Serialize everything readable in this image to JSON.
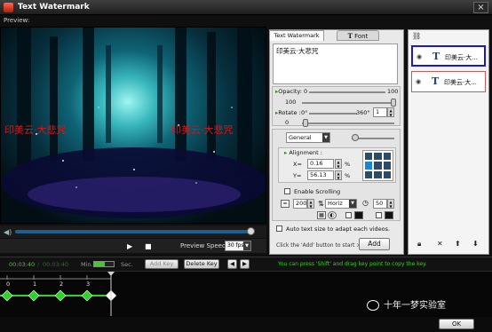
{
  "window": {
    "title": "Text Watermark",
    "close_glyph": "×"
  },
  "preview": {
    "label": "Preview:",
    "watermark_texts": [
      "印美云·大悲咒",
      "印美云·大悲咒"
    ],
    "seek_progress": 0.98,
    "speed_label": "Preview Speed",
    "speed_value": "30 fps/s"
  },
  "text_tab": {
    "tab_label": "Text Watermark",
    "font_button": "Font",
    "text_value": "印美云·大悲咒",
    "opacity_label": "Opacity:",
    "opacity_min": "0",
    "opacity_max": "100",
    "opacity_value": "100",
    "rotate_label": "Rotate :",
    "rotate_min": "0°",
    "rotate_max": "360°",
    "rotate_value": "0",
    "rotate_step": "1",
    "style_select": "General",
    "alignment_label": "Alignment :",
    "x_label": "X=",
    "x_value": "0.16",
    "y_label": "Y=",
    "y_value": "56.13",
    "percent": "%",
    "scrolling_label": "Enable Scrolling",
    "scroll_speed": "200",
    "scroll_direction": "Horiz",
    "scroll_time": "50",
    "auto_size_label": "Auto text size to adapt each videos.",
    "hint": "Click the 'Add' button to start >>",
    "add_button": "Add"
  },
  "watermark_list": {
    "items": [
      {
        "text": "印美云·大...",
        "selected": true
      },
      {
        "text": "印美云·大...",
        "selected": false
      }
    ]
  },
  "timeline": {
    "current_time": "00:03:40",
    "total_time": "00:03:40",
    "min_label": "Min.",
    "sec_label": "Sec.",
    "add_key": "Add Key",
    "delete_key": "Delete Key",
    "hint": "You can press 'Shift' and drag key point to copy the key.",
    "tick_labels": [
      "0",
      "1",
      "2",
      "3"
    ]
  },
  "footer": {
    "ok_button": "OK",
    "overlay_text": "十年一梦实验室"
  },
  "colors": {
    "selection_blue": "#1a1acc",
    "keyframe_green": "#2fd12a",
    "watermark_red": "#d41818"
  }
}
